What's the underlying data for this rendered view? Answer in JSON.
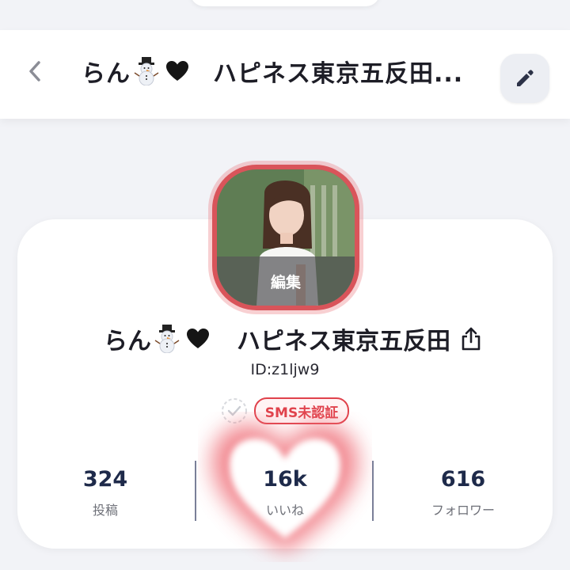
{
  "header": {
    "title_prefix": "らん",
    "title_suffix": "ハピネス東京五反田..."
  },
  "profile": {
    "avatar_overlay_label": "編集",
    "name_prefix": "らん",
    "name_suffix": "ハピネス東京五反田",
    "user_id": "ID:z1ljw9",
    "sms_badge": "SMS未認証"
  },
  "stats": [
    {
      "value": "324",
      "label": "投稿"
    },
    {
      "value": "16k",
      "label": "いいね"
    },
    {
      "value": "616",
      "label": "フォロワー"
    }
  ],
  "icons": {
    "back": "chevron-left-icon",
    "edit": "pencil-icon",
    "share": "share-icon",
    "verified": "check-circle-icon",
    "emoji_1": "snowman-icon",
    "emoji_2": "black-heart-icon"
  },
  "colors": {
    "accent_red": "#e0424c",
    "avatar_ring": "#d9545a",
    "stat_value": "#1e2a4a",
    "background": "#f2f3f7"
  }
}
